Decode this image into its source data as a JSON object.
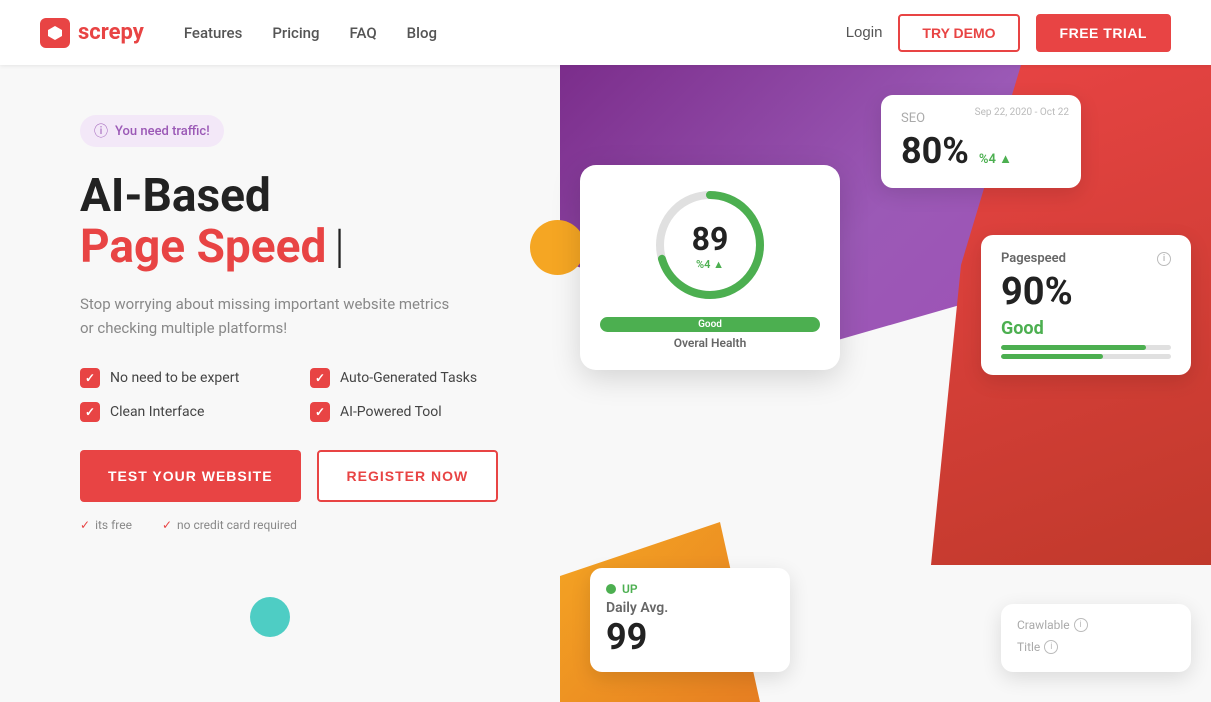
{
  "navbar": {
    "logo_text": "screpy",
    "nav_links": [
      {
        "label": "Features",
        "href": "#"
      },
      {
        "label": "Pricing",
        "href": "#"
      },
      {
        "label": "FAQ",
        "href": "#"
      },
      {
        "label": "Blog",
        "href": "#"
      }
    ],
    "login_label": "Login",
    "try_demo_label": "TRY DEMO",
    "free_trial_label": "FREE TRIAL"
  },
  "hero": {
    "badge_text": "You need traffic!",
    "title_line1": "AI-Based",
    "title_line2": "Page Speed",
    "subtitle": "Stop worrying about missing important website metrics or checking multiple platforms!",
    "features": [
      {
        "label": "No need to be expert"
      },
      {
        "label": "Auto-Generated Tasks"
      },
      {
        "label": "Clean Interface"
      },
      {
        "label": "AI-Powered Tool"
      }
    ],
    "cta_primary": "TEST YOUR WEBSITE",
    "cta_secondary": "REGISTER NOW",
    "note1": "its free",
    "note2": "no credit card required"
  },
  "cards": {
    "overall_health": {
      "title": "Overal Health",
      "value": "89",
      "change": "%4 ▲",
      "status": "Good"
    },
    "seo": {
      "title": "SEO",
      "value": "80%",
      "change": "%4 ▲",
      "date": "Sep 22, 2020 - Oct 22"
    },
    "pagespeed": {
      "title": "Pagespeed",
      "value": "90%",
      "status": "Good"
    },
    "daily": {
      "up_label": "UP",
      "title": "Daily Avg.",
      "value": "99"
    },
    "crawlable": {
      "title": "Crawlable",
      "title2": "Title"
    }
  }
}
